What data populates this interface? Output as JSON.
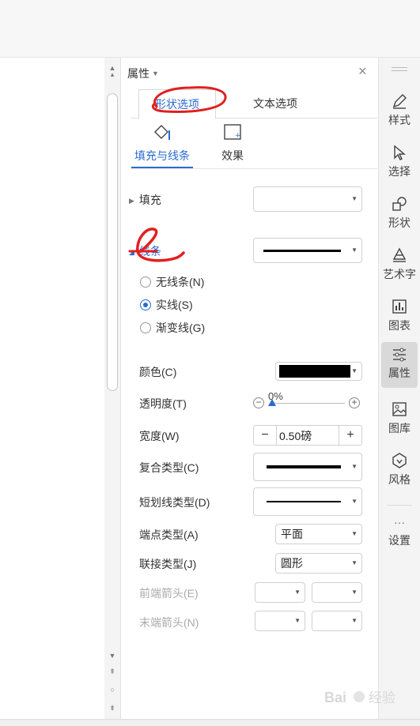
{
  "panel": {
    "title": "属性",
    "tabs": [
      "形状选项",
      "文本选项"
    ],
    "subtabs": [
      "填充与线条",
      "效果"
    ]
  },
  "fill": {
    "label": "填充"
  },
  "line": {
    "label": "线条",
    "options": [
      "无线条(N)",
      "实线(S)",
      "渐变线(G)"
    ],
    "selected": "实线(S)"
  },
  "props": {
    "color_label": "颜色(C)",
    "color_value": "#000000",
    "transparency_label": "透明度(T)",
    "transparency_value": "0%",
    "width_label": "宽度(W)",
    "width_value": "0.50磅",
    "compound_label": "复合类型(C)",
    "dash_label": "短划线类型(D)",
    "cap_label": "端点类型(A)",
    "cap_value": "平面",
    "join_label": "联接类型(J)",
    "join_value": "圆形",
    "begin_arrow_label": "前端箭头(E)",
    "end_arrow_label": "末端箭头(N)"
  },
  "rightbar": {
    "items": [
      {
        "label": "样式",
        "icon": "pen-icon"
      },
      {
        "label": "选择",
        "icon": "cursor-icon"
      },
      {
        "label": "形状",
        "icon": "shapes-icon"
      },
      {
        "label": "艺术字",
        "icon": "wordart-icon"
      },
      {
        "label": "图表",
        "icon": "chart-icon"
      },
      {
        "label": "属性",
        "icon": "sliders-icon"
      },
      {
        "label": "图库",
        "icon": "image-icon"
      },
      {
        "label": "风格",
        "icon": "style-icon"
      },
      {
        "label": "设置",
        "icon": "more-icon"
      }
    ],
    "active": "属性"
  },
  "watermark": {
    "text": "Bai 经验"
  }
}
